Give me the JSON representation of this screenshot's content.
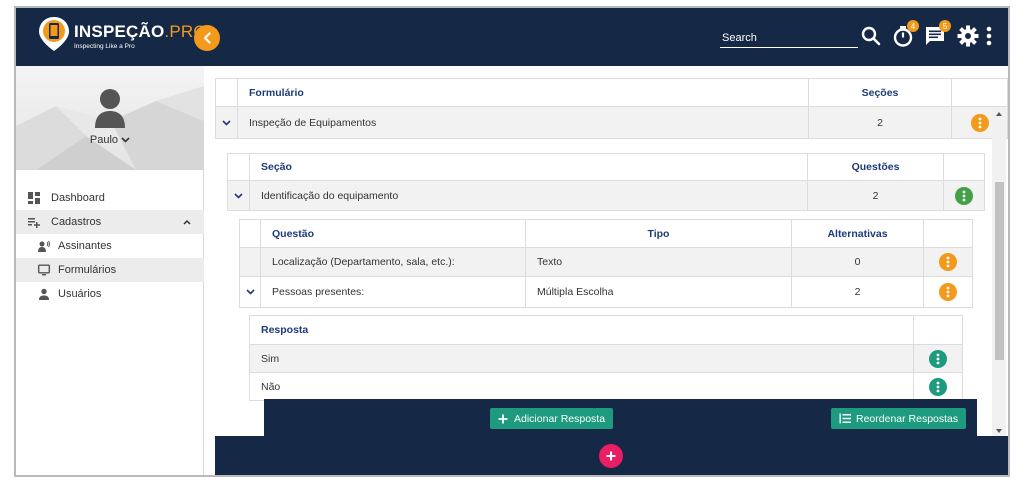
{
  "header": {
    "logo_main": "INSPEÇÃO",
    "logo_accent": ".PRO",
    "logo_tagline": "Inspecting Like a Pro",
    "search_placeholder": "Search",
    "timer_badge": "4",
    "messages_badge": "5"
  },
  "sidebar": {
    "user_name": "Paulo",
    "items": [
      {
        "label": "Dashboard",
        "icon": "dashboard-icon"
      },
      {
        "label": "Cadastros",
        "icon": "playlist-add-icon"
      },
      {
        "label": "Assinantes",
        "icon": "record-voice-icon"
      },
      {
        "label": "Formulários",
        "icon": "monitor-icon"
      },
      {
        "label": "Usuários",
        "icon": "person-icon"
      }
    ]
  },
  "forms_table": {
    "headers": {
      "name": "Formulário",
      "sections": "Seções"
    },
    "row": {
      "name": "Inspeção de Equipamentos",
      "sections": "2"
    }
  },
  "sections_table": {
    "headers": {
      "name": "Seção",
      "questions": "Questões"
    },
    "row": {
      "name": "Identificação do equipamento",
      "questions": "2"
    }
  },
  "questions_table": {
    "headers": {
      "question": "Questão",
      "type": "Tipo",
      "alternatives": "Alternativas"
    },
    "rows": [
      {
        "question": "Localização (Departamento, sala, etc.):",
        "type": "Texto",
        "alternatives": "0"
      },
      {
        "question": "Pessoas presentes:",
        "type": "Múltipla Escolha",
        "alternatives": "2"
      }
    ]
  },
  "answers_table": {
    "header": "Resposta",
    "rows": [
      {
        "answer": "Sim"
      },
      {
        "answer": "Não"
      }
    ]
  },
  "actions": {
    "add_answer": "Adicionar Resposta",
    "reorder_answers": "Reordenar Respostas"
  },
  "colors": {
    "navy": "#152846",
    "orange": "#f39a1c",
    "green": "#43a047",
    "teal": "#1e9a7f",
    "pink": "#e91e63",
    "header_text": "#1f3a7a"
  }
}
